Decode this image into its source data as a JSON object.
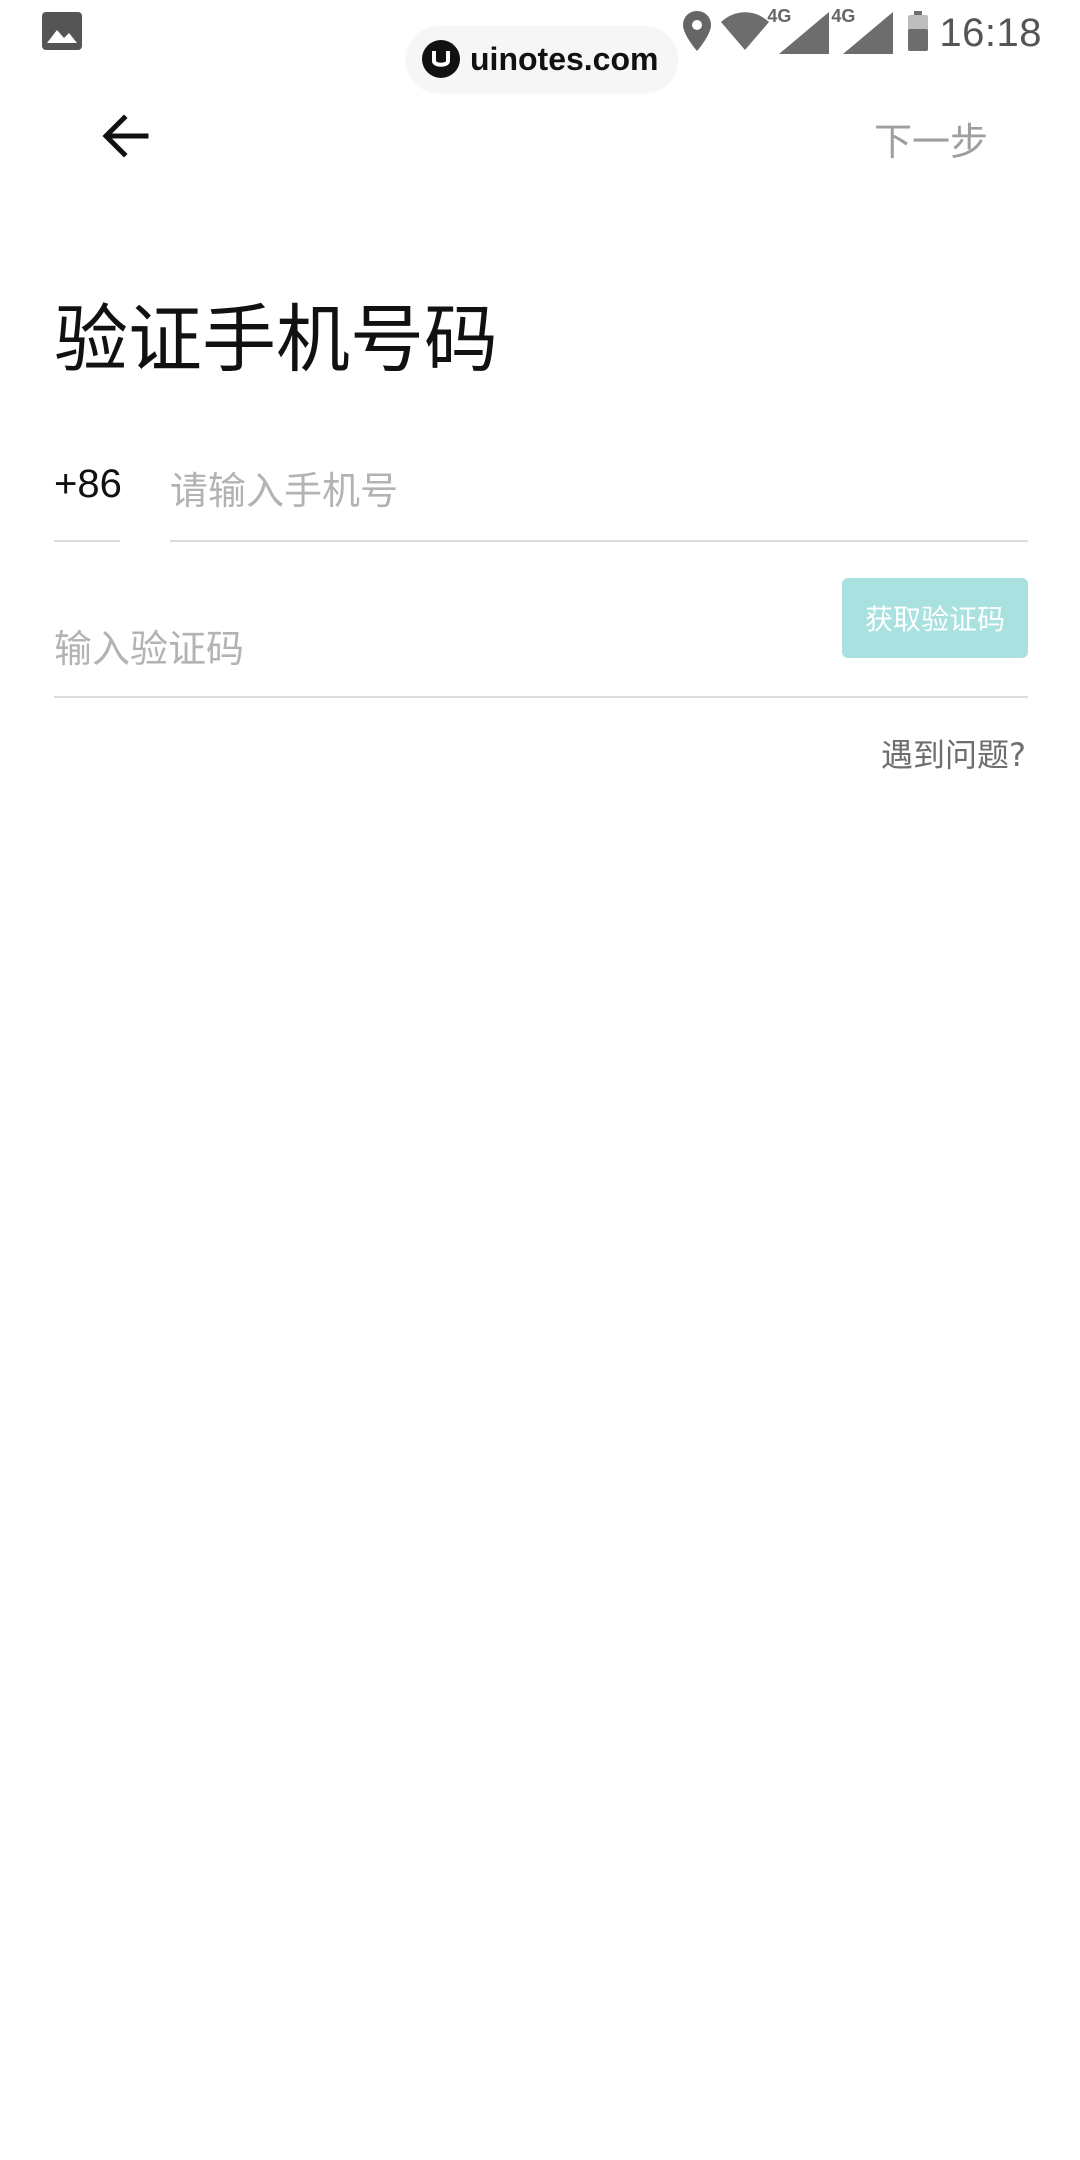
{
  "status_bar": {
    "time": "16:18",
    "network_1": "4G",
    "network_2": "4G",
    "icons": [
      "image-icon",
      "location-icon",
      "wifi-icon",
      "signal-icon",
      "signal-icon",
      "battery-icon"
    ]
  },
  "watermark": {
    "text": "uinotes.com"
  },
  "nav": {
    "back_icon": "arrow-left-icon",
    "next_label": "下一步"
  },
  "title": "验证手机号码",
  "phone": {
    "country_code": "+86",
    "placeholder": "请输入手机号"
  },
  "verification": {
    "placeholder": "输入验证码",
    "get_code_label": "获取验证码"
  },
  "help_label": "遇到问题?",
  "colors": {
    "accent_disabled": "#a9e1e0",
    "placeholder": "#b3b3b3",
    "divider": "#dcdcdc",
    "secondary_text": "#9e9e9e"
  }
}
